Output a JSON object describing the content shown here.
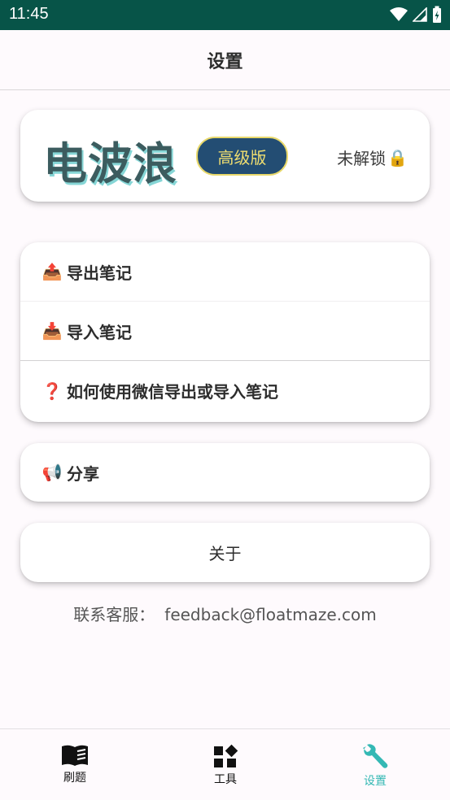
{
  "status_bar": {
    "time": "11:45"
  },
  "app_bar": {
    "title": "设置"
  },
  "hero": {
    "title": "电波浪",
    "badge": "高级版",
    "lock_status": "未解锁",
    "lock_icon": "🔒"
  },
  "menu": {
    "items": [
      {
        "icon": "📤",
        "label": "导出笔记"
      },
      {
        "icon": "📥",
        "label": "导入笔记"
      },
      {
        "icon": "❓",
        "label": "如何使用微信导出或导入笔记"
      }
    ]
  },
  "share": {
    "icon": "📢",
    "label": "分享"
  },
  "about": {
    "label": "关于"
  },
  "contact": {
    "label": "联系客服：",
    "email": "feedback@floatmaze.com"
  },
  "bottom_nav": {
    "items": [
      {
        "label": "刷题",
        "icon": "book-icon"
      },
      {
        "label": "工具",
        "icon": "widgets-icon"
      },
      {
        "label": "设置",
        "icon": "wrench-icon"
      }
    ],
    "active_color": "#34b8b4",
    "inactive_color": "#111111"
  },
  "colors": {
    "status_bar": "#075448",
    "badge_bg": "#234d73",
    "badge_text": "#f0de70",
    "hero_title": "#3c5c5f"
  }
}
